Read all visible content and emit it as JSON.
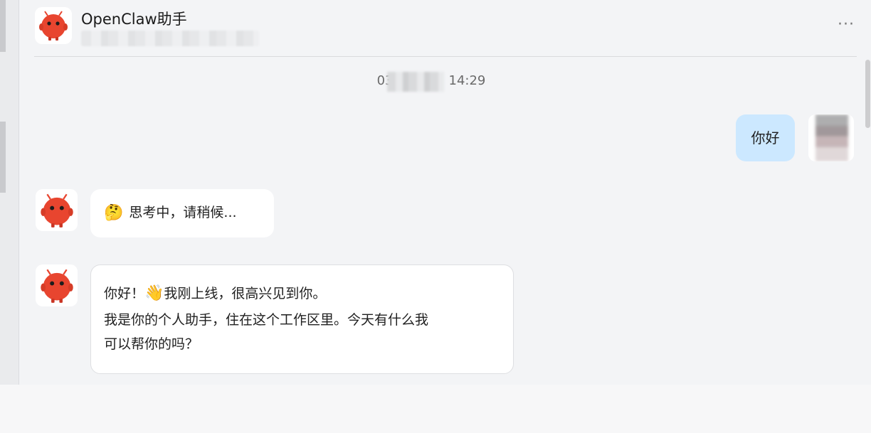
{
  "header": {
    "title": "OpenClaw助手",
    "more_label": "···"
  },
  "timestamp": {
    "prefix": "03",
    "suffix": "14:29"
  },
  "messages": [
    {
      "role": "user",
      "text": "你好"
    },
    {
      "role": "bot",
      "emoji": "🤔",
      "text": "思考中，请稍候..."
    },
    {
      "role": "bot",
      "line1_pre": "你好！",
      "line1_emoji": "👋",
      "line1_post": "我刚上线，很高兴见到你。",
      "line2": "我是你的个人助手，住在这个工作区里。今天有什么我",
      "line3": "可以帮你的吗？"
    }
  ],
  "colors": {
    "user_bubble": "#cce8ff",
    "bot_bubble": "#ffffff",
    "mascot": "#e8452f",
    "background": "#f3f4f6"
  },
  "icons": {
    "bot_avatar": "lobster-mascot-icon",
    "more": "more-dots-icon"
  }
}
